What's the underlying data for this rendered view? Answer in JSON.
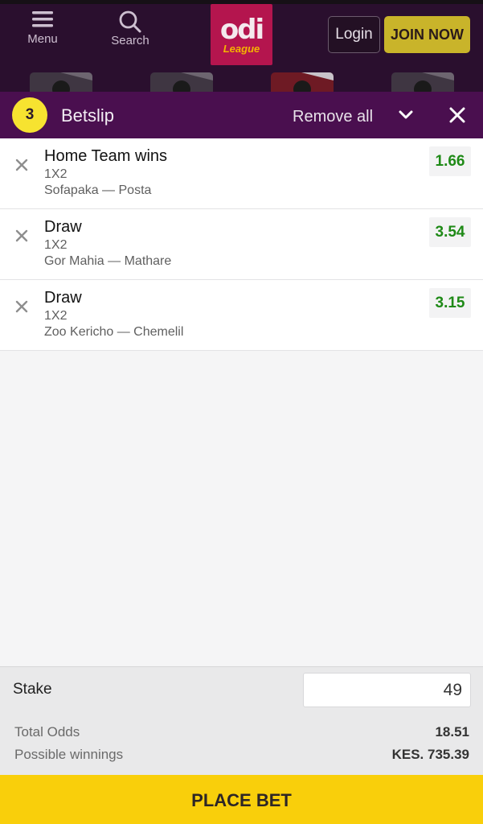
{
  "header": {
    "menu_label": "Menu",
    "search_label": "Search",
    "logo_main": "odi",
    "logo_sub": "League",
    "login_label": "Login",
    "join_label": "JOIN NOW",
    "colors": {
      "bar": "#2a0f2e",
      "logo": "#b4154e",
      "join": "#c9b42a"
    }
  },
  "betslip": {
    "count": "3",
    "title": "Betslip",
    "remove_all_label": "Remove all",
    "collapse_icon": "chevron-down-icon",
    "close_icon": "close-icon",
    "bar_color": "#4a0f4f",
    "badge_color": "#f7e330"
  },
  "bets": [
    {
      "selection": "Home Team wins",
      "market": "1X2",
      "match": "Sofapaka — Posta",
      "odds": "1.66"
    },
    {
      "selection": "Draw",
      "market": "1X2",
      "match": "Gor Mahia — Mathare",
      "odds": "3.54"
    },
    {
      "selection": "Draw",
      "market": "1X2",
      "match": "Zoo Kericho — Chemelil",
      "odds": "3.15"
    }
  ],
  "summary": {
    "stake_label": "Stake",
    "stake_value": "49",
    "total_odds_label": "Total Odds",
    "total_odds_value": "18.51",
    "possible_winnings_label": "Possible winnings",
    "possible_winnings_value": "KES. 735.39"
  },
  "place_bet_label": "PLACE BET",
  "accent_colors": {
    "odds_green": "#1f8a17",
    "place_bet": "#f9cf0b"
  }
}
